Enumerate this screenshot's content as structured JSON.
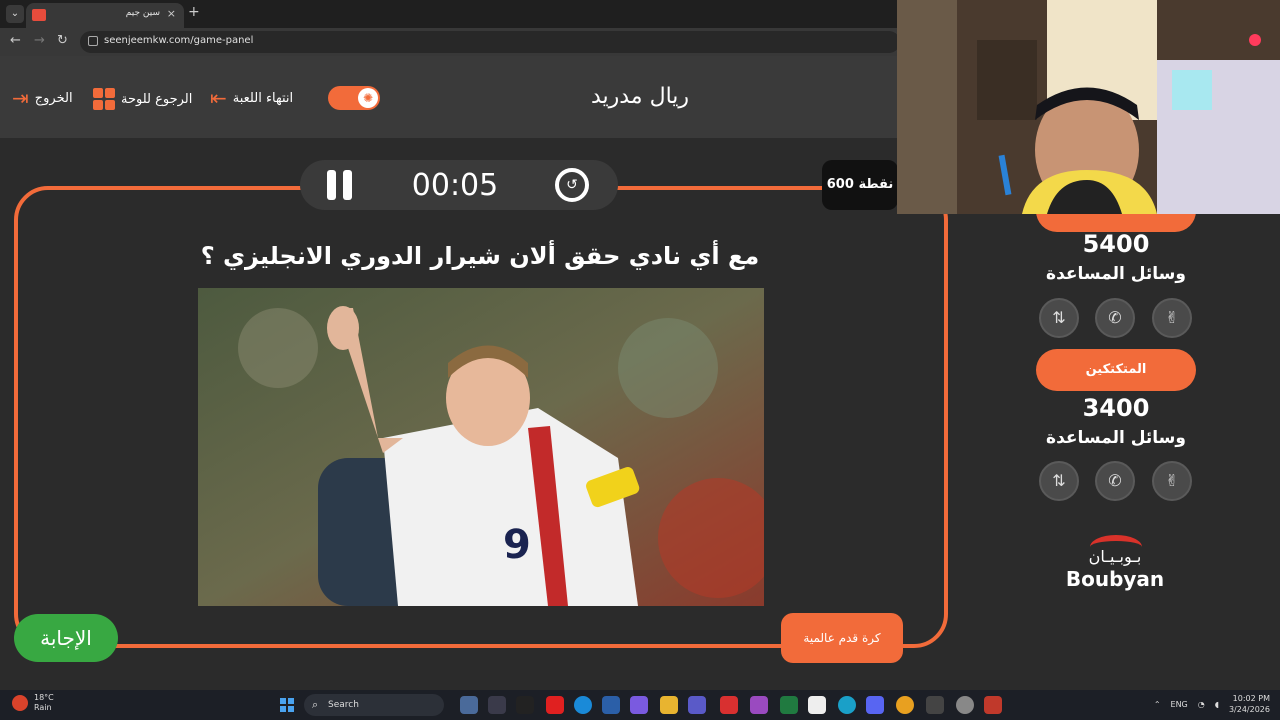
{
  "browser": {
    "tab_title": "سين جيم",
    "tab_close": "×",
    "new_tab": "+",
    "tab_menu": "⌄",
    "back": "←",
    "forward": "→",
    "reload": "↻",
    "url": "seenjeemkw.com/game-panel"
  },
  "header": {
    "exit_label": "الخروج",
    "back_to_board_label": "الرجوع للوحة",
    "end_game_label": "انتهاء اللعبة",
    "team_title": "ريال مدريد"
  },
  "game": {
    "timer": "00:05",
    "points": "600 نقطة",
    "question": "مع أي نادي حقق ألان شيرار الدوري الانجليزي ؟",
    "category": "كرة قدم عالمية",
    "answer_label": "الإجابة"
  },
  "scoreboard": {
    "team1_score": "5400",
    "team1_aids_label": "وسائل المساعدة",
    "team2_name": "المتكتكين",
    "team2_score": "3400",
    "team2_aids_label": "وسائل المساعدة"
  },
  "sponsor": {
    "arabic": "بـوبـيـان",
    "english": "Boubyan"
  },
  "taskbar": {
    "temperature": "18°C",
    "weather": "Rain",
    "search": "Search",
    "language": "ENG",
    "time": "10:02 PM",
    "date": "3/24/2026"
  },
  "icons": {
    "aid_swap": "⇅",
    "aid_call": "✆",
    "aid_two": "✌",
    "reset": "↺",
    "toggle": "✺",
    "exit": "⇥",
    "end": "⇤"
  },
  "colors": {
    "accent": "#f26b3a",
    "answer_green": "#38a842",
    "background": "#2b2b2b"
  }
}
